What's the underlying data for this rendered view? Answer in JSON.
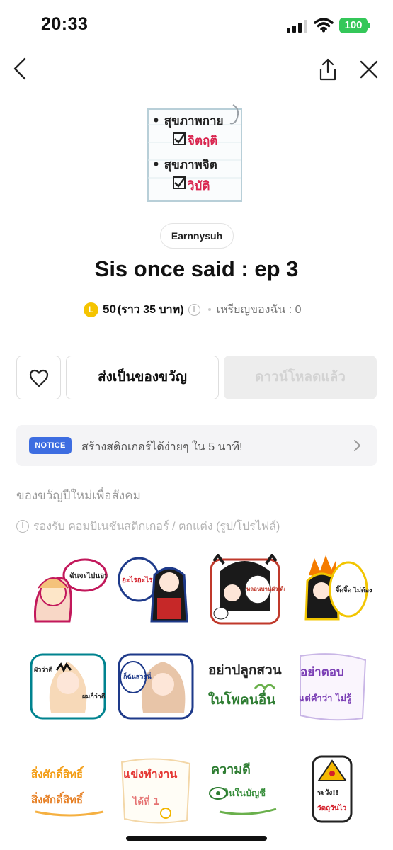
{
  "status_bar": {
    "time": "20:33",
    "battery": "100",
    "battery_color": "#34c759",
    "icons": [
      "signal-icon",
      "wifi-icon",
      "battery-icon"
    ]
  },
  "nav": {
    "icons": [
      "back-chevron-icon",
      "share-icon",
      "close-icon"
    ]
  },
  "hero": {
    "sticker_lines": [
      "• สุขภาพกาย",
      "จิตฤติ",
      "• สุขภาพจิต",
      "วิบัติ"
    ]
  },
  "author": "Earnnysuh",
  "title": "Sis once said : ep 3",
  "price": {
    "coin_symbol": "L",
    "amount": "50",
    "approx": "(ราว 35 บาท)",
    "my_coins": "เหรียญของฉัน : 0",
    "coin_color": "#f5c400"
  },
  "actions": {
    "gift_label": "ส่งเป็นของขวัญ",
    "download_label": "ดาวน์โหลดแล้ว"
  },
  "notice": {
    "badge": "NOTICE",
    "text": "สร้างสติกเกอร์ได้ง่ายๆ ใน 5 นาที!",
    "badge_color": "#3d6de1"
  },
  "section_label": "ของขวัญปีใหม่เพื่อสังคม",
  "support_text": "รองรับ คอมบิเนชันสติกเกอร์ / ตกแต่ง (รูป/โปรไฟล์)",
  "stickers": [
    {
      "text": "ฉันจะไปนอนต่ออ"
    },
    {
      "text": "อะไรอะไรก็กู!!"
    },
    {
      "text": "หลอนบานผัวเดือน"
    },
    {
      "text": "จี๊ดจี๊ด ไม่ต้องทำได้"
    },
    {
      "text": "ผัวว่าดี",
      "text2": "ผมก็ว่าดี"
    },
    {
      "text": "ก็ฉันสวยนี่"
    },
    {
      "text": "อย่าปลูกสวน",
      "text2": "ในโพคนอื่น"
    },
    {
      "text": "อย่าตอบ",
      "text2": "แต่คำว่า ไม่รู้"
    },
    {
      "text": "สิ่งศักดิ์สิทธิ์",
      "text2": "สิ่งศักดิ์สิทธิ์"
    },
    {
      "text": "แข่งทำงาน",
      "text2": "ได้ที่ 1"
    },
    {
      "text": "ความดี",
      "text2": "เงินในบัญชี"
    },
    {
      "text": "ระวัง!!",
      "text2": "วัตถุวันไว"
    }
  ]
}
